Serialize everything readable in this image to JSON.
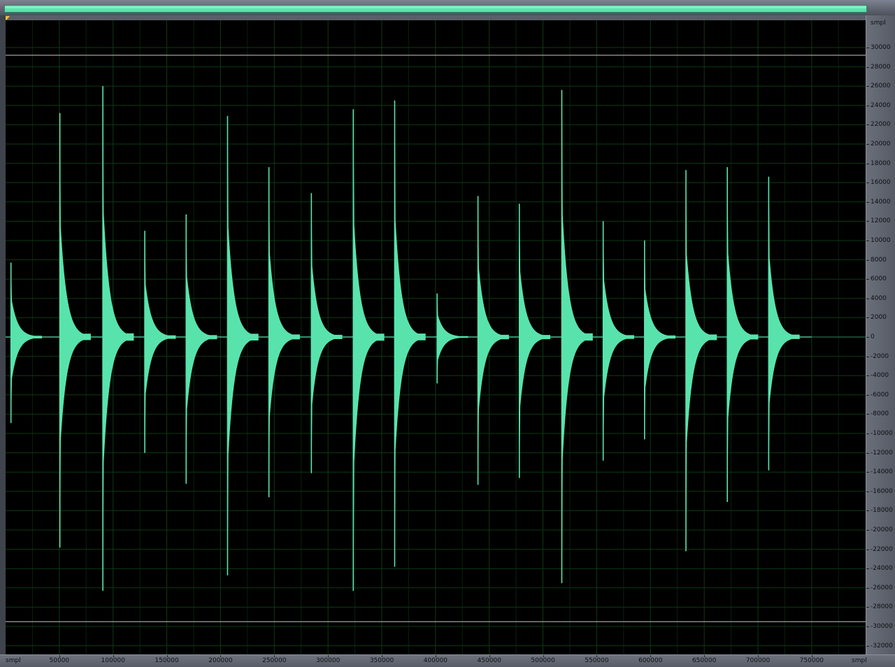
{
  "overview": {
    "fill_fraction": 1.0,
    "color": "#59e3ac"
  },
  "colors": {
    "waveform": "#59e3ac",
    "background": "#000000",
    "grid": "#0c3a12",
    "center_line": "#3fa37a",
    "clip_line": "#c9c9c9"
  },
  "ruler": {
    "y_unit": "smpl",
    "x_unit_left": "smpl",
    "x_unit_right": "smpl"
  },
  "chart_data": {
    "type": "line",
    "xlim": [
      0,
      800000
    ],
    "ylim": [
      -33000,
      33000
    ],
    "y_ticks": [
      30000,
      28000,
      26000,
      24000,
      22000,
      20000,
      18000,
      16000,
      14000,
      12000,
      10000,
      8000,
      6000,
      4000,
      2000,
      0,
      -2000,
      -4000,
      -6000,
      -8000,
      -10000,
      -12000,
      -14000,
      -16000,
      -18000,
      -20000,
      -22000,
      -24000,
      -26000,
      -28000,
      -30000,
      -32000
    ],
    "x_ticks": [
      50000,
      100000,
      150000,
      200000,
      250000,
      300000,
      350000,
      400000,
      450000,
      500000,
      550000,
      600000,
      650000,
      700000,
      750000
    ],
    "clip_levels": [
      29200,
      -29500
    ],
    "transients": [
      {
        "x": 5000,
        "max": 7700,
        "min": -8900
      },
      {
        "x": 50500,
        "max": 23200,
        "min": -21800
      },
      {
        "x": 90500,
        "max": 26000,
        "min": -26300
      },
      {
        "x": 129500,
        "max": 11000,
        "min": -12000
      },
      {
        "x": 168000,
        "max": 12700,
        "min": -15200
      },
      {
        "x": 206500,
        "max": 22900,
        "min": -24700
      },
      {
        "x": 245000,
        "max": 17600,
        "min": -16600
      },
      {
        "x": 284500,
        "max": 14900,
        "min": -14100
      },
      {
        "x": 323500,
        "max": 23600,
        "min": -26300
      },
      {
        "x": 362000,
        "max": 24500,
        "min": -23800
      },
      {
        "x": 401500,
        "max": 4500,
        "min": -4800
      },
      {
        "x": 439500,
        "max": 14600,
        "min": -15300
      },
      {
        "x": 478000,
        "max": 13800,
        "min": -14600
      },
      {
        "x": 517500,
        "max": 25600,
        "min": -25500
      },
      {
        "x": 556000,
        "max": 12000,
        "min": -12800
      },
      {
        "x": 594500,
        "max": 10000,
        "min": -10600
      },
      {
        "x": 633000,
        "max": 17300,
        "min": -22200
      },
      {
        "x": 671500,
        "max": 17600,
        "min": -17100
      },
      {
        "x": 710000,
        "max": 16600,
        "min": -13800
      }
    ],
    "signal_end_x": 750000
  }
}
